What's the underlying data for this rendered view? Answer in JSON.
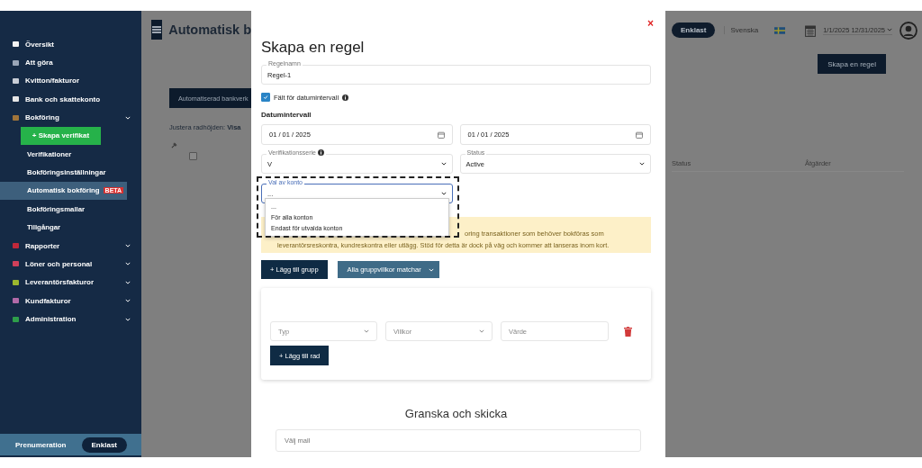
{
  "sidebar": {
    "items": [
      {
        "label": "Översikt",
        "kind": "link",
        "color": "#f2f2f2"
      },
      {
        "label": "Att göra",
        "kind": "link",
        "color": "#9aa6b8"
      },
      {
        "label": "Kvitton/fakturor",
        "kind": "link",
        "color": "#c8cdd6"
      },
      {
        "label": "Bank och skattekonto",
        "kind": "link",
        "color": "#e6e6e6"
      },
      {
        "label": "Bokföring",
        "kind": "group",
        "color": "#a0743a",
        "children": [
          {
            "label": "+ Skapa verifikat",
            "kind": "action"
          },
          {
            "label": "Verifikationer",
            "kind": "link",
            "selected": false
          },
          {
            "label": "Bokföringsinställningar",
            "kind": "link",
            "selected": false
          },
          {
            "label": "Automatisk bokföring",
            "kind": "link",
            "selected": true,
            "badge": "BETA"
          },
          {
            "label": "Bokföringsmallar",
            "kind": "link",
            "selected": false
          },
          {
            "label": "Tillgångar",
            "kind": "link",
            "selected": false
          }
        ]
      },
      {
        "label": "Rapporter",
        "kind": "group",
        "color": "#c0283a"
      },
      {
        "label": "Löner och personal",
        "kind": "group",
        "color": "#d0405a"
      },
      {
        "label": "Leverantörsfakturor",
        "kind": "group",
        "color": "#9cb82e"
      },
      {
        "label": "Kundfakturor",
        "kind": "group",
        "color": "#b26aa8"
      },
      {
        "label": "Administration",
        "kind": "group",
        "color": "#2e9e4a"
      }
    ],
    "subscription": {
      "label": "Prenumeration",
      "plan": "Enklast"
    }
  },
  "page": {
    "title": "Automatisk b",
    "tab_button": "Automatiserad bankverk",
    "row_height_label": "Justera radhöjden:",
    "row_height_value": "Visa",
    "create_button": "Skapa en regel",
    "row_checked": false,
    "table_columns": [
      "Status",
      "Åtgärder"
    ]
  },
  "topbar": {
    "plan": "Enklast",
    "language": "Svenska",
    "date_range": "1/1/2025 12/31/2025"
  },
  "modal": {
    "close": "×",
    "title": "Skapa en regel",
    "rule_name": {
      "label": "Regelnamn",
      "value": "Regel-1"
    },
    "date_range_toggle": {
      "label": "Fält för datumintervall",
      "checked": true
    },
    "date_section": "Datumintervall",
    "dates": [
      {
        "value": "01 / 01 / 2025"
      },
      {
        "value": "01 / 01 / 2025"
      }
    ],
    "selects": [
      {
        "label": "Verifikationsserie",
        "info": true,
        "value": "V"
      },
      {
        "label": "Status",
        "info": false,
        "value": "Active"
      }
    ],
    "account_select": {
      "label": "Val av konto",
      "value": "...",
      "focused": true,
      "options": [
        "...",
        "För alla konton",
        "Endast för utvalda konton"
      ]
    },
    "alert": {
      "lines": [
        "oring transaktioner som behöver bokföras som",
        "leverantörsreskontra, kundreskontra eller utlägg. Stöd för detta är dock på väg och kommer att lanseras inom kort."
      ]
    },
    "group_button": "+ Lägg till grupp",
    "match_select": "Alla gruppvillkor matchar",
    "conditions": [
      {
        "type_placeholder": "Typ",
        "condition_placeholder": "Villkor",
        "value_placeholder": "Värde"
      }
    ],
    "add_row_button": "+ Lägg till rad",
    "review_title": "Granska och skicka",
    "template_placeholder": "Välj mall"
  }
}
